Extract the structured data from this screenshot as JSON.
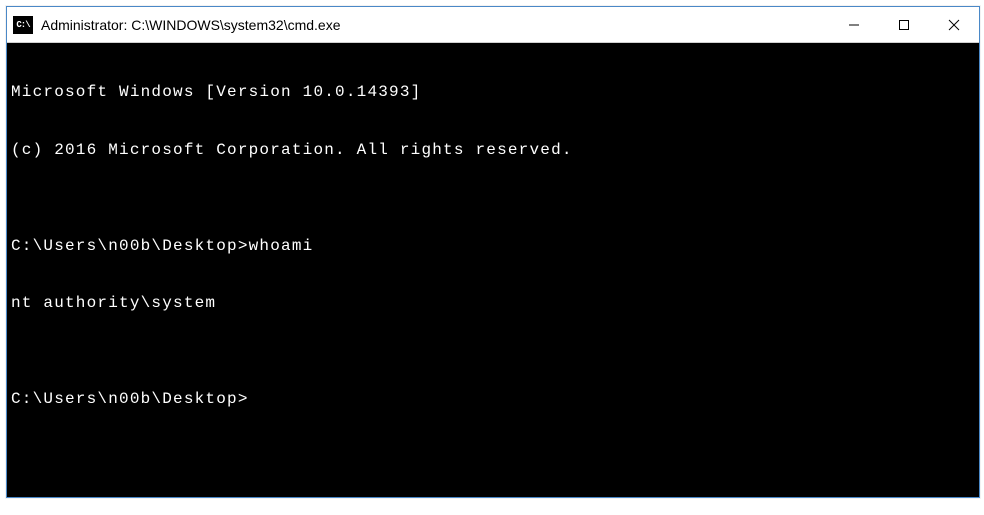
{
  "window": {
    "title": "Administrator: C:\\WINDOWS\\system32\\cmd.exe",
    "icon_label": "C:\\"
  },
  "terminal": {
    "lines": [
      "Microsoft Windows [Version 10.0.14393]",
      "(c) 2016 Microsoft Corporation. All rights reserved.",
      "",
      "C:\\Users\\n00b\\Desktop>whoami",
      "nt authority\\system",
      "",
      "C:\\Users\\n00b\\Desktop>"
    ]
  }
}
